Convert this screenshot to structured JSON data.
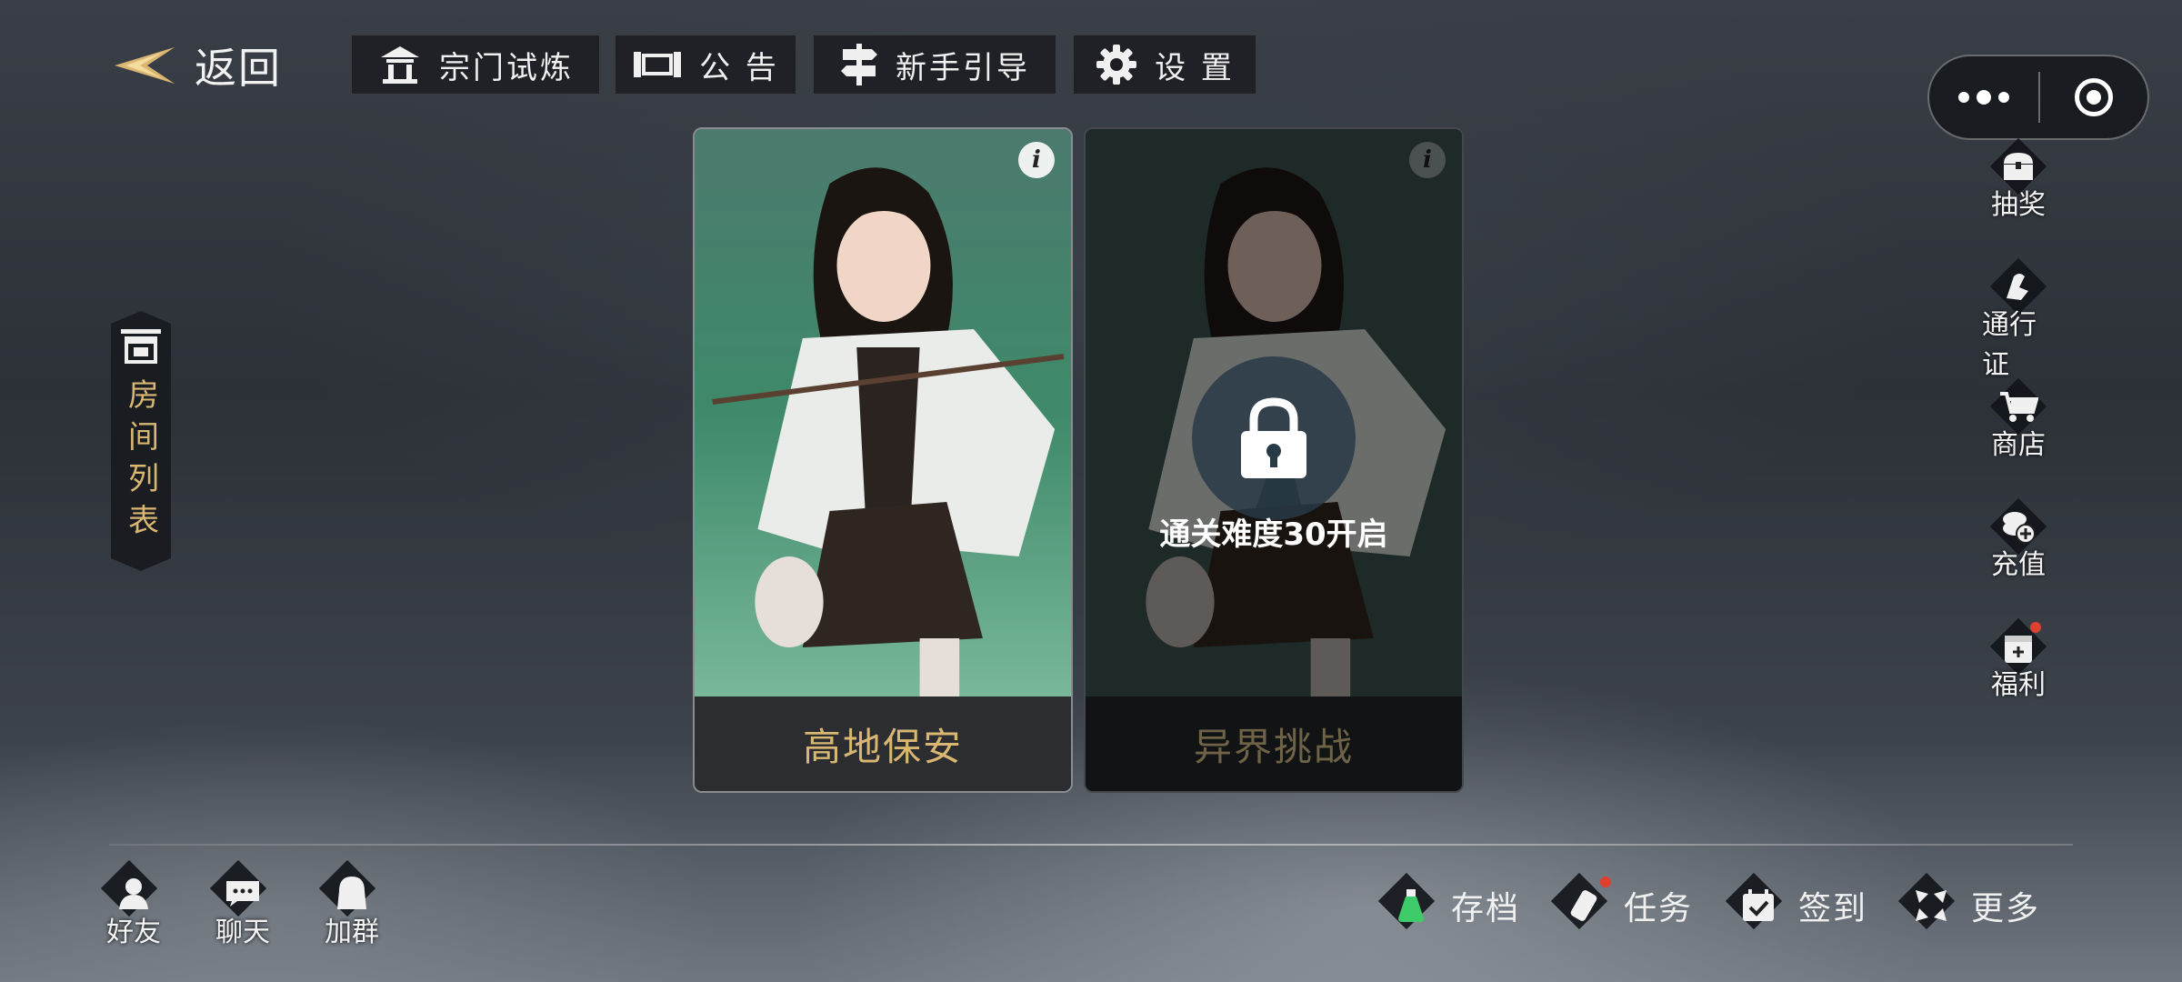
{
  "header": {
    "back_label": "返回",
    "buttons": [
      {
        "label": "宗门试炼",
        "icon": "pavilion-icon"
      },
      {
        "label": "公 告",
        "icon": "scroll-icon"
      },
      {
        "label": "新手引导",
        "icon": "signpost-icon"
      },
      {
        "label": "设 置",
        "icon": "gear-icon"
      }
    ]
  },
  "left_panel": {
    "room_list_label": "房间列表"
  },
  "cards": [
    {
      "title": "高地保安",
      "locked": false,
      "title_color": "#d9b772"
    },
    {
      "title": "异界挑战",
      "locked": true,
      "lock_text": "通关难度30开启",
      "title_color": "#6e6346"
    }
  ],
  "right_menu": [
    {
      "label": "抽奖",
      "icon": "treasure-chest-icon"
    },
    {
      "label": "通行证",
      "icon": "pass-icon"
    },
    {
      "label": "商店",
      "icon": "cart-icon"
    },
    {
      "label": "充值",
      "icon": "coins-icon"
    },
    {
      "label": "福利",
      "icon": "gift-icon"
    }
  ],
  "bottom_left": [
    {
      "label": "好友",
      "icon": "friend-icon"
    },
    {
      "label": "聊天",
      "icon": "chat-icon"
    },
    {
      "label": "加群",
      "icon": "group-icon"
    }
  ],
  "bottom_right": [
    {
      "label": "存档",
      "icon": "potion-icon"
    },
    {
      "label": "任务",
      "icon": "scroll-task-icon"
    },
    {
      "label": "签到",
      "icon": "calendar-check-icon"
    },
    {
      "label": "更多",
      "icon": "more-arrows-icon"
    }
  ],
  "colors": {
    "accent_gold": "#d9b772",
    "panel_dark": "#1c1e22"
  }
}
